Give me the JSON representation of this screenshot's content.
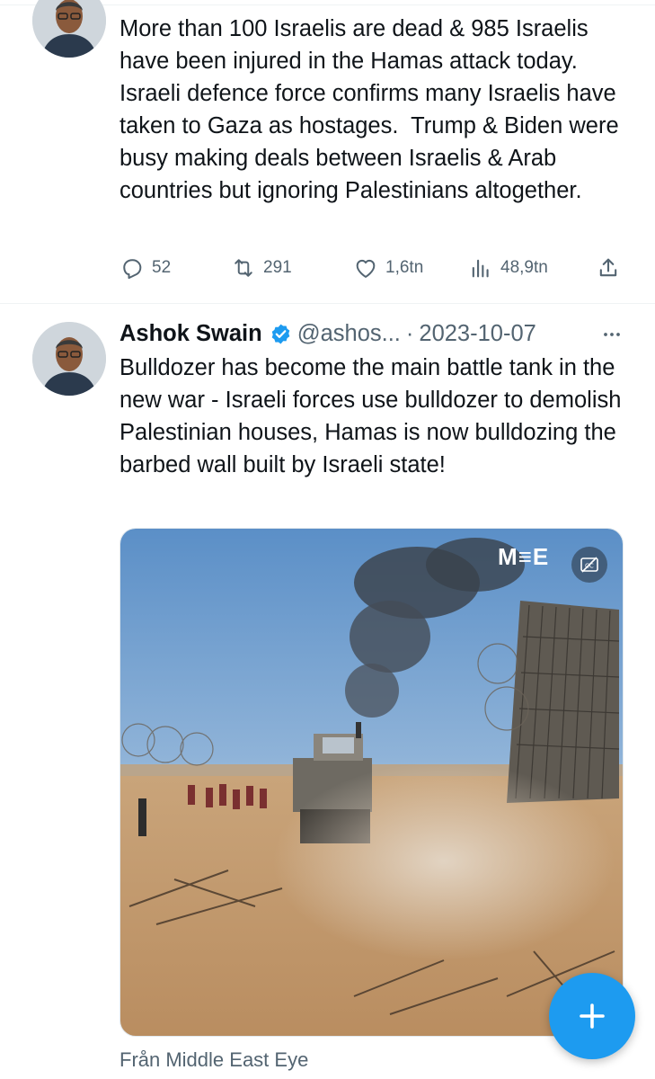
{
  "tweets": [
    {
      "text": "More than 100 Israelis are dead & 985 Israelis have been injured in the Hamas attack today. Israeli defence force confirms many Israelis have taken to Gaza as hostages.  Trump & Biden were busy making deals between Israelis & Arab countries but ignoring Palestinians altogether.",
      "avatar_icon": "profile-photo",
      "actions": {
        "replies": "52",
        "retweets": "291",
        "likes": "1,6tn",
        "views": "48,9tn"
      }
    },
    {
      "author_name": "Ashok Swain",
      "verified_icon": "verified-badge-icon",
      "handle": "@ashos...",
      "separator": "·",
      "date": "2023-10-07",
      "text": "Bulldozer has become the main battle tank in the new war - Israeli forces use bulldozer to demolish Palestinian houses, Hamas is now bulldozing the barbed wall built by Israeli state!",
      "media": {
        "watermark": "M≡E",
        "caption_icon": "captions-off-icon"
      },
      "source": "Från Middle East Eye"
    }
  ],
  "colors": {
    "accent": "#1d9bf0",
    "secondary_text": "#536471",
    "primary_text": "#0f1419"
  }
}
